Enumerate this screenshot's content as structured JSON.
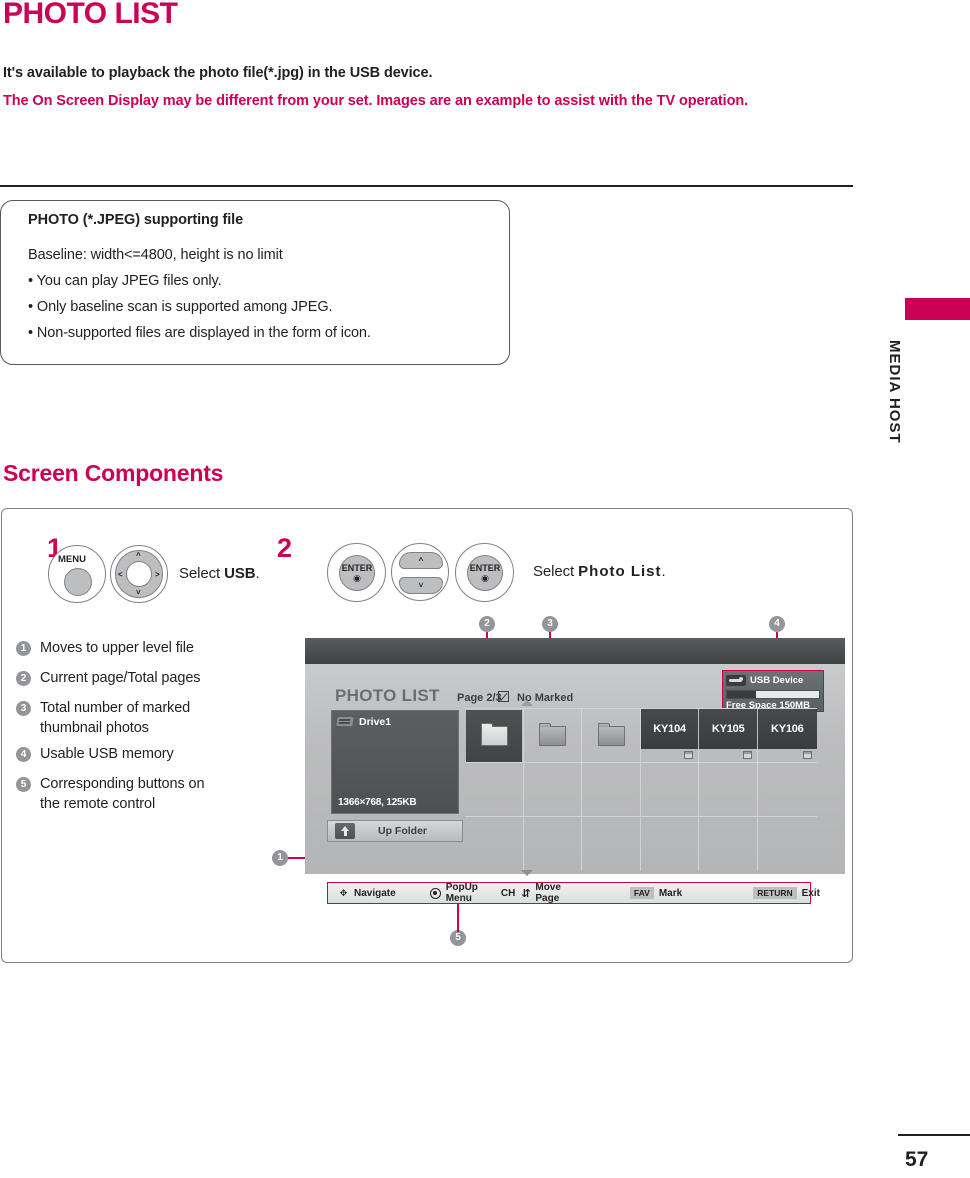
{
  "document": {
    "title": "PHOTO LIST",
    "intro_line_1": "It's available to playback the photo file(*.jpg) in the USB device.",
    "intro_line_2": "The On Screen Display may be different from your set. Images are an example to assist with the TV operation.",
    "page_number": "57",
    "sidebar_label": "MEDIA HOST",
    "accent_color": "#CC0055"
  },
  "info_box": {
    "title": "PHOTO (*.JPEG) supporting file",
    "lines": [
      "Baseline: width<=4800, height is no limit",
      "• You can play JPEG files only.",
      "• Only baseline scan is supported among JPEG.",
      "• Non-supported files are displayed in the form of icon."
    ]
  },
  "section": {
    "heading": "Screen Components"
  },
  "steps": [
    {
      "number": "1",
      "buttons": [
        "MENU",
        "d-pad"
      ],
      "menu_label": "MENU",
      "instruction_prefix": "Select ",
      "instruction_target": "USB",
      "instruction_suffix": "."
    },
    {
      "number": "2",
      "buttons": [
        "ENTER",
        "up-down",
        "ENTER"
      ],
      "enter_label": "ENTER",
      "instruction_prefix": "Select ",
      "instruction_target": "Photo List",
      "instruction_suffix": "."
    }
  ],
  "legend": [
    {
      "num": "1",
      "text": "Moves to upper level file"
    },
    {
      "num": "2",
      "text": "Current page/Total pages"
    },
    {
      "num": "3",
      "text": "Total number of marked thumbnail photos"
    },
    {
      "num": "4",
      "text": "Usable USB memory"
    },
    {
      "num": "5",
      "text": "Corresponding buttons on the remote control"
    }
  ],
  "callouts": [
    {
      "id": "1",
      "label": "1"
    },
    {
      "id": "2",
      "label": "2"
    },
    {
      "id": "3",
      "label": "3"
    },
    {
      "id": "4",
      "label": "4"
    },
    {
      "id": "5",
      "label": "5"
    }
  ],
  "tv_screen": {
    "heading": "PHOTO LIST",
    "page_indicator": "Page 2/3",
    "marked_status": "No Marked",
    "usb": {
      "device_label": "USB Device",
      "free_space": "Free Space 150MB",
      "bar_fill_percent": 32
    },
    "drive": {
      "name": "Drive1",
      "preview_meta": "1366×768, 125KB"
    },
    "up_folder_label": "Up Folder",
    "grid": {
      "columns": 6,
      "rows": 3,
      "folders": [
        {
          "selected": true
        },
        {
          "selected": false
        },
        {
          "selected": false
        }
      ],
      "photos": [
        {
          "label": "KY104",
          "marked": false
        },
        {
          "label": "KY105",
          "marked": false
        },
        {
          "label": "KY106",
          "marked": false
        }
      ]
    },
    "nav_bar": [
      {
        "icon": "navigate-icon",
        "label": "Navigate"
      },
      {
        "icon": "wheel-icon",
        "label": "PopUp Menu"
      },
      {
        "icon": "ch-updown-icon",
        "label": "Move Page",
        "prefix": "CH"
      },
      {
        "icon": "fav-key",
        "key": "FAV",
        "label": "Mark"
      },
      {
        "icon": "return-key",
        "key": "RETURN",
        "label": "Exit"
      }
    ]
  }
}
